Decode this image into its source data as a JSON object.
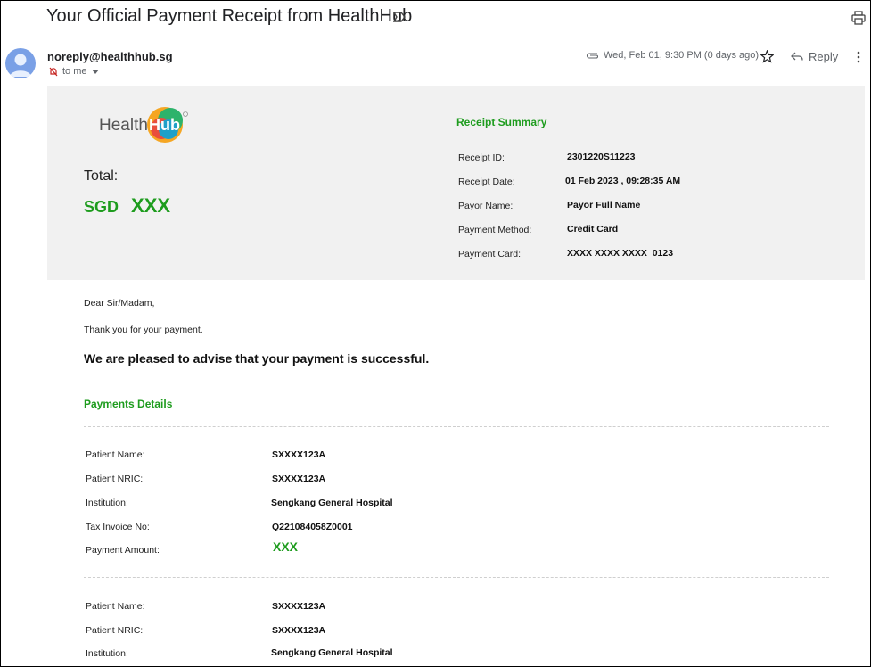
{
  "email": {
    "subject": "Your Official Payment Receipt from HealthHub",
    "sender": "noreply@healthhub.sg",
    "to_label": "to me",
    "date": "Wed, Feb 01, 9:30 PM (0 days ago)",
    "reply_label": "Reply"
  },
  "logo": {
    "text": "Health",
    "hub": "Hub"
  },
  "total": {
    "label": "Total:",
    "currency": "SGD",
    "amount": "XXX"
  },
  "receipt_summary": {
    "title": "Receipt Summary",
    "rows": [
      {
        "label": "Receipt ID:",
        "value": "2301220S11223"
      },
      {
        "label": "Receipt Date:",
        "value": "01 Feb 2023 , 09:28:35 AM"
      },
      {
        "label": "Payor Name:",
        "value": "Payor Full Name"
      },
      {
        "label": "Payment Method:",
        "value": "Credit Card"
      },
      {
        "label": "Payment Card:",
        "value": "XXXX XXXX XXXX  0123"
      }
    ]
  },
  "body": {
    "greeting": "Dear Sir/Madam,",
    "thanks": "Thank you for your payment.",
    "success": "We are pleased to advise that your payment is successful.",
    "details_title": "Payments Details"
  },
  "payments": [
    {
      "labels": [
        "Patient Name:",
        "Patient NRIC:",
        "Institution:",
        "Tax Invoice No:",
        "Payment Amount:"
      ],
      "patient_name": "SXXXX123A",
      "patient_nric": "SXXXX123A",
      "institution": "Sengkang General Hospital",
      "tax_invoice": "Q221084058Z0001",
      "amount": "XXX"
    },
    {
      "labels": [
        "Patient Name:",
        "Patient NRIC:",
        "Institution:"
      ],
      "patient_name": "SXXXX123A",
      "patient_nric": "SXXXX123A",
      "institution": "Sengkang General Hospital"
    }
  ],
  "colors": {
    "accent_green": "#1e9c1e",
    "summary_bg": "#f1f1f1"
  },
  "icons": [
    "label-icon",
    "print-icon",
    "avatar-icon",
    "attachment-icon",
    "star-icon",
    "reply-icon",
    "more-icon",
    "chevron-down-icon",
    "muted-icon"
  ]
}
